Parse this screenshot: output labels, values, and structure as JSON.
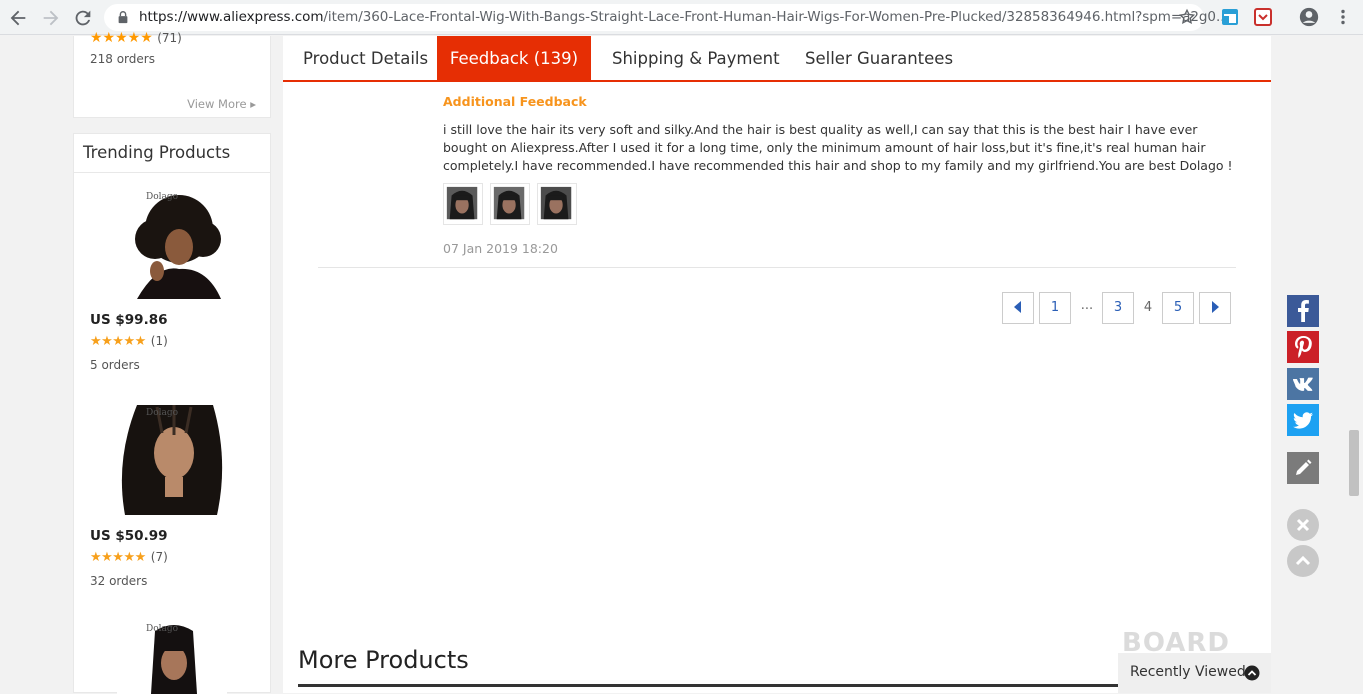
{
  "browser": {
    "url_host": "https://www.aliexpress.com",
    "url_path": "/item/360-Lace-Frontal-Wig-With-Bangs-Straight-Lace-Front-Human-Hair-Wigs-For-Women-Pre-Plucked/32858364946.html?spm=a2g0..."
  },
  "sidebar": {
    "top_product": {
      "rating_count": "(71)",
      "orders": "218 orders",
      "view_more": "View More ▸"
    },
    "trending_title": "Trending Products",
    "trending": [
      {
        "brand": "Dolago",
        "price": "US $99.86",
        "stars": "★★★★★",
        "rating_count": "(1)",
        "orders": "5 orders"
      },
      {
        "brand": "Dolago",
        "price": "US $50.99",
        "stars": "★★★★★",
        "rating_count": "(7)",
        "orders": "32 orders"
      },
      {
        "brand": "Dolago"
      }
    ]
  },
  "tabs": [
    {
      "label": "Product Details",
      "active": false
    },
    {
      "label": "Feedback (139)",
      "active": true
    },
    {
      "label": "Shipping & Payment",
      "active": false
    },
    {
      "label": "Seller Guarantees",
      "active": false
    }
  ],
  "feedback": {
    "heading": "Additional Feedback",
    "text": "i still love the hair its very soft and silky.And the hair is best quality as well,I can say that this is the best hair I have ever bought on Aliexpress.After I used it for a long time, only the minimum amount of hair loss,but it's fine,it's real human hair completely.I have recommended.I have recommended this hair and shop to my family and my girlfriend.You are best Dolago !",
    "date": "07 Jan 2019 18:20",
    "image_count": 3
  },
  "pagination": {
    "pages": [
      "1",
      "...",
      "3",
      "4",
      "5"
    ],
    "current": "4"
  },
  "more_products_title": "More Products",
  "recently_viewed": {
    "label": "Recently Viewed",
    "watermark": "BOARD"
  },
  "colors": {
    "accent": "#e62e04",
    "feedback_heading": "#f7941d",
    "star": "#f7a01c",
    "facebook": "#3b5998",
    "pinterest": "#cb2027",
    "vk": "#4c75a3",
    "twitter": "#1da1f2"
  }
}
